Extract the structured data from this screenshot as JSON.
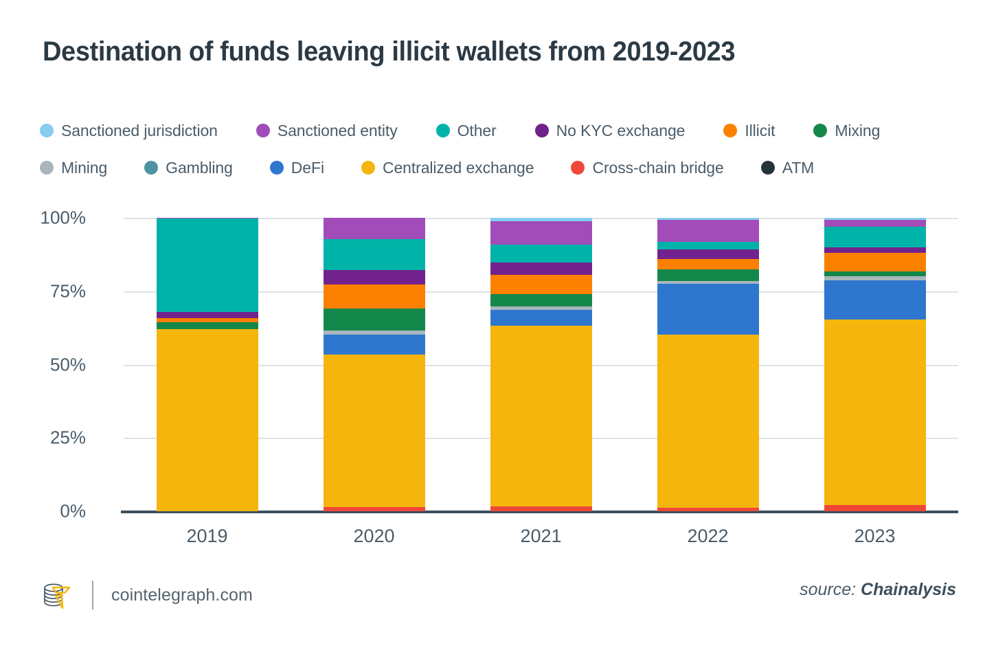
{
  "header": {
    "title": "Destination of funds leaving illicit wallets from 2019-2023"
  },
  "footer": {
    "logo_icon": "cointelegraph-coin-stack-logo",
    "site": "cointelegraph.com",
    "source_prefix": "source:",
    "source_name": "Chainalysis"
  },
  "legend": {
    "rows": [
      [
        {
          "label": "Sanctioned jurisdiction",
          "color": "#86cdf0"
        },
        {
          "label": "Sanctioned entity",
          "color": "#a14cb8"
        },
        {
          "label": "Other",
          "color": "#00b3a8"
        },
        {
          "label": "No KYC exchange",
          "color": "#72228c"
        },
        {
          "label": "Illicit",
          "color": "#fb8000"
        },
        {
          "label": "Mixing",
          "color": "#14874a"
        }
      ],
      [
        {
          "label": "Mining",
          "color": "#a9b6bd"
        },
        {
          "label": "Gambling",
          "color": "#4d94a3"
        },
        {
          "label": "DeFi",
          "color": "#2f77ce"
        },
        {
          "label": "Centralized exchange",
          "color": "#f5b50d"
        },
        {
          "label": "Cross-chain bridge",
          "color": "#ef4738"
        },
        {
          "label": "ATM",
          "color": "#22333c"
        }
      ]
    ]
  },
  "chart_data": {
    "type": "bar",
    "subtype": "stacked-100-percent",
    "title": "Destination of funds leaving illicit wallets from 2019-2023",
    "xlabel": "",
    "ylabel": "",
    "ylim": [
      0,
      100
    ],
    "ytick_labels": [
      "0%",
      "25%",
      "50%",
      "75%",
      "100%"
    ],
    "ytick_values": [
      0,
      25,
      50,
      75,
      100
    ],
    "grid": true,
    "legend_position": "top",
    "categories": [
      "2019",
      "2020",
      "2021",
      "2022",
      "2023"
    ],
    "series": [
      {
        "name": "Cross-chain bridge",
        "color": "#ef4738",
        "values": [
          0.0,
          1.5,
          1.6,
          1.2,
          2.2
        ]
      },
      {
        "name": "Centralized exchange",
        "color": "#f5b50d",
        "values": [
          62.0,
          51.8,
          61.7,
          59.0,
          63.1
        ]
      },
      {
        "name": "DeFi",
        "color": "#2f77ce",
        "values": [
          0.0,
          7.0,
          5.4,
          17.3,
          13.3
        ]
      },
      {
        "name": "Mining",
        "color": "#a9b6bd",
        "values": [
          0.0,
          1.4,
          1.2,
          0.9,
          1.6
        ]
      },
      {
        "name": "Gambling",
        "color": "#4d94a3",
        "values": [
          0.0,
          0.0,
          0.0,
          0.0,
          0.0
        ]
      },
      {
        "name": "Mixing",
        "color": "#14874a",
        "values": [
          2.3,
          7.3,
          4.0,
          4.0,
          1.6
        ]
      },
      {
        "name": "Illicit",
        "color": "#fb8000",
        "values": [
          1.6,
          8.4,
          6.6,
          3.5,
          6.3
        ]
      },
      {
        "name": "No KYC exchange",
        "color": "#72228c",
        "values": [
          2.1,
          4.9,
          4.2,
          3.3,
          1.9
        ]
      },
      {
        "name": "Other",
        "color": "#00b3a8",
        "values": [
          31.7,
          10.5,
          6.1,
          2.6,
          7.0
        ]
      },
      {
        "name": "Sanctioned entity",
        "color": "#a14cb8",
        "values": [
          0.3,
          7.2,
          8.0,
          7.5,
          2.3
        ]
      },
      {
        "name": "Sanctioned jurisdiction",
        "color": "#86cdf0",
        "values": [
          0.0,
          0.0,
          1.2,
          0.7,
          0.7
        ]
      },
      {
        "name": "ATM",
        "color": "#22333c",
        "values": [
          0.0,
          0.0,
          0.0,
          0.0,
          0.0
        ]
      }
    ]
  }
}
